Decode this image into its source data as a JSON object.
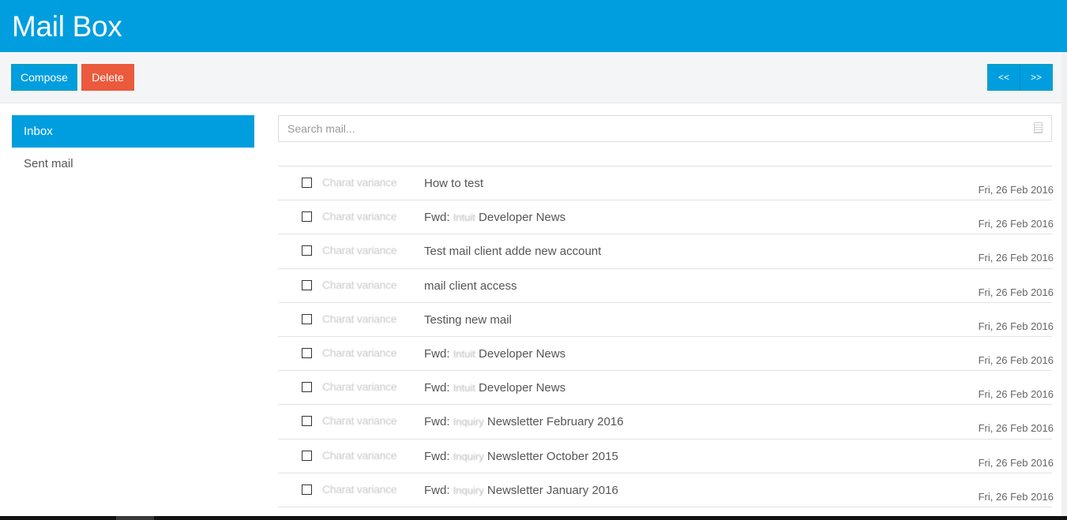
{
  "header": {
    "title": "Mail Box"
  },
  "toolbar": {
    "compose_label": "Compose",
    "delete_label": "Delete",
    "prev_label": "<<",
    "next_label": ">>"
  },
  "sidebar": {
    "items": [
      {
        "label": "Inbox",
        "active": true
      },
      {
        "label": "Sent mail",
        "active": false
      }
    ]
  },
  "search": {
    "placeholder": "Search mail..."
  },
  "mails": [
    {
      "sender": "Charat variance",
      "subject_prefix": "",
      "subject_blur": "",
      "subject": "How to test",
      "date": "Fri, 26 Feb 2016"
    },
    {
      "sender": "Charat variance",
      "subject_prefix": "Fwd:",
      "subject_blur": "Intuit",
      "subject": "Developer News",
      "date": "Fri, 26 Feb 2016"
    },
    {
      "sender": "Charat variance",
      "subject_prefix": "",
      "subject_blur": "",
      "subject": "Test mail client adde new account",
      "date": "Fri, 26 Feb 2016"
    },
    {
      "sender": "Charat variance",
      "subject_prefix": "",
      "subject_blur": "",
      "subject": "mail client access",
      "date": "Fri, 26 Feb 2016"
    },
    {
      "sender": "Charat variance",
      "subject_prefix": "",
      "subject_blur": "",
      "subject": "Testing new mail",
      "date": "Fri, 26 Feb 2016"
    },
    {
      "sender": "Charat variance",
      "subject_prefix": "Fwd:",
      "subject_blur": "Intuit",
      "subject": "Developer News",
      "date": "Fri, 26 Feb 2016"
    },
    {
      "sender": "Charat variance",
      "subject_prefix": "Fwd:",
      "subject_blur": "Intuit",
      "subject": "Developer News",
      "date": "Fri, 26 Feb 2016"
    },
    {
      "sender": "Charat variance",
      "subject_prefix": "Fwd:",
      "subject_blur": "Inquiry",
      "subject": "Newsletter February 2016",
      "date": "Fri, 26 Feb 2016"
    },
    {
      "sender": "Charat variance",
      "subject_prefix": "Fwd:",
      "subject_blur": "Inquiry",
      "subject": "Newsletter October 2015",
      "date": "Fri, 26 Feb 2016"
    },
    {
      "sender": "Charat variance",
      "subject_prefix": "Fwd:",
      "subject_blur": "Inquiry",
      "subject": "Newsletter January 2016",
      "date": "Fri, 26 Feb 2016"
    }
  ],
  "icons": {
    "search": "notepad-icon"
  },
  "colors": {
    "primary": "#009edf",
    "danger": "#eb5a3c",
    "toolbar_bg": "#f4f5f7"
  }
}
